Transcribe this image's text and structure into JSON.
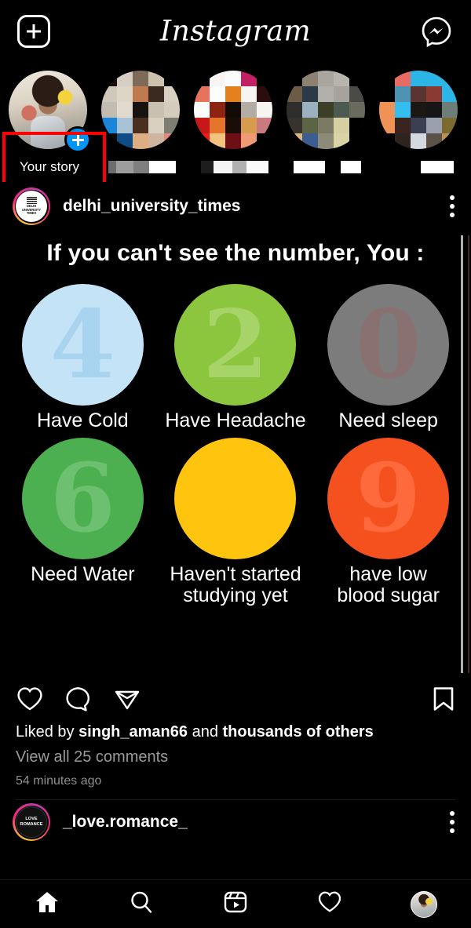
{
  "header": {
    "add_icon": "plus-square-icon",
    "title": "Instagram",
    "messenger_icon": "messenger-icon"
  },
  "stories": {
    "items": [
      {
        "label": "Your story",
        "type": "own",
        "badge": "plus-badge",
        "highlighted": true
      },
      {
        "label": "",
        "type": "censored"
      },
      {
        "label": "",
        "type": "censored"
      },
      {
        "label": "",
        "type": "censored"
      },
      {
        "label": "",
        "type": "censored"
      }
    ]
  },
  "post": {
    "username": "delhi_university_times",
    "avatar_text_line1": "DELHI",
    "avatar_text_line2": "UNIVERSITY",
    "avatar_text_line3": "TIMES",
    "menu_icon": "more-options-icon",
    "image": {
      "title": "If you can't see the number, You :",
      "cells": [
        {
          "number": "4",
          "label": "Have Cold",
          "circle_color": "#c5e3f6",
          "number_color": "#a9d4f0"
        },
        {
          "number": "2",
          "label": "Have Headache",
          "circle_color": "#8cc63e",
          "number_color": "#a7d469"
        },
        {
          "number": "0",
          "label": "Need sleep",
          "circle_color": "#7c7c7c",
          "number_color": "#8a7171"
        },
        {
          "number": "6",
          "label": "Need Water",
          "circle_color": "#4caf50",
          "number_color": "#6cc06f"
        },
        {
          "number": "",
          "label": "Haven't started\nstudying yet",
          "circle_color": "#ffc40d",
          "number_color": "#ffc40d"
        },
        {
          "number": "9",
          "label": "have low\nblood sugar",
          "circle_color": "#f4511e",
          "number_color": "#ff6a3c"
        }
      ]
    },
    "actions": {
      "like_icon": "heart-icon",
      "comment_icon": "comment-icon",
      "share_icon": "share-paper-plane-icon",
      "save_icon": "bookmark-icon"
    },
    "liked_by_prefix": "Liked by ",
    "liked_by_user": "singh_aman66",
    "liked_by_middle": " and ",
    "liked_by_others": "thousands of others",
    "view_comments": "View all 25 comments",
    "timestamp": "54 minutes ago"
  },
  "next_post": {
    "username": "_love.romance_",
    "avatar_text_line1": "LOVE",
    "avatar_text_line2": "ROMANCE",
    "menu_icon": "more-options-icon"
  },
  "bottom_nav": {
    "items": [
      {
        "name": "home-icon",
        "active": true
      },
      {
        "name": "search-icon",
        "active": false
      },
      {
        "name": "reels-icon",
        "active": false
      },
      {
        "name": "activity-heart-icon",
        "active": false
      },
      {
        "name": "profile-avatar",
        "active": false
      }
    ]
  },
  "annotation": {
    "type": "red-highlight-box",
    "color": "#ff0000",
    "target": "Your story"
  }
}
